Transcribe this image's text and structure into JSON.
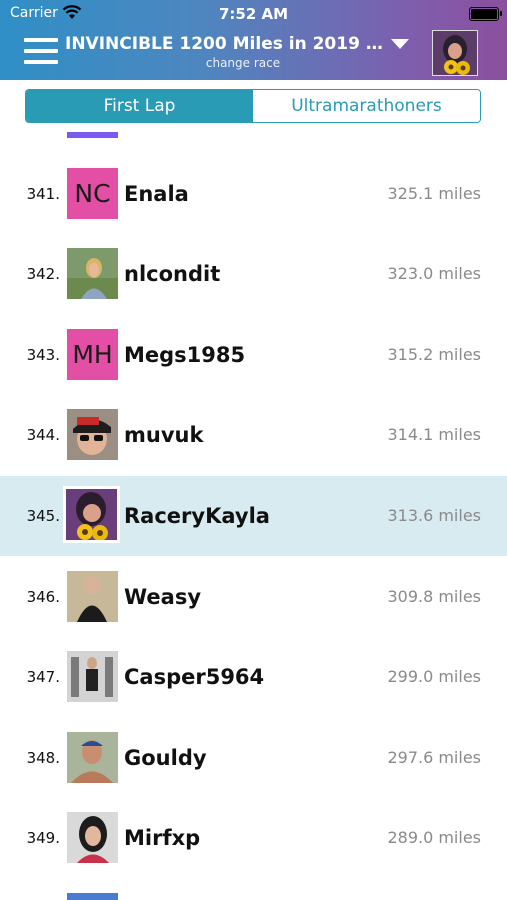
{
  "status_bar": {
    "carrier": "Carrier",
    "time": "7:52 AM"
  },
  "header": {
    "title": "INVINCIBLE 1200 Miles in 2019 Ch...",
    "subtitle": "change race"
  },
  "tabs": [
    {
      "label": "First Lap",
      "active": true
    },
    {
      "label": "Ultramarathoners",
      "active": false
    }
  ],
  "colors": {
    "accent": "#2a9bb5",
    "initials_bg": "#e24fa4",
    "selected_row": "#d8ebf0"
  },
  "leaderboard": [
    {
      "rank": "341.",
      "name": "Enala",
      "miles": "325.1 miles",
      "avatar": "initials",
      "initials": "NC"
    },
    {
      "rank": "342.",
      "name": "nlcondit",
      "miles": "323.0 miles",
      "avatar": "photo"
    },
    {
      "rank": "343.",
      "name": "Megs1985",
      "miles": "315.2 miles",
      "avatar": "initials",
      "initials": "MH"
    },
    {
      "rank": "344.",
      "name": "muvuk",
      "miles": "314.1 miles",
      "avatar": "photo"
    },
    {
      "rank": "345.",
      "name": "RaceryKayla",
      "miles": "313.6 miles",
      "avatar": "photo",
      "selected": true
    },
    {
      "rank": "346.",
      "name": "Weasy",
      "miles": "309.8 miles",
      "avatar": "photo"
    },
    {
      "rank": "347.",
      "name": "Casper5964",
      "miles": "299.0 miles",
      "avatar": "photo"
    },
    {
      "rank": "348.",
      "name": "Gouldy",
      "miles": "297.6 miles",
      "avatar": "photo"
    },
    {
      "rank": "349.",
      "name": "Mirfxp",
      "miles": "289.0 miles",
      "avatar": "photo"
    }
  ]
}
